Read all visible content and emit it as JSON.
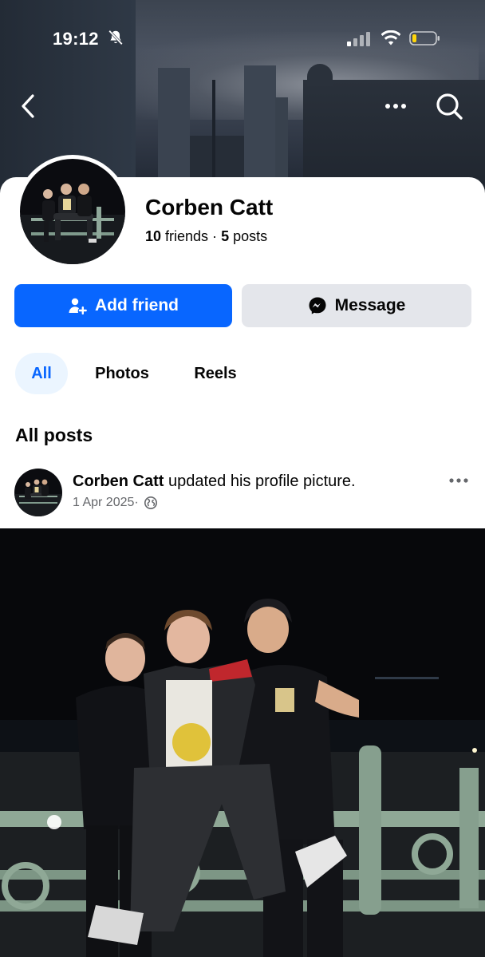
{
  "status_bar": {
    "time": "19:12",
    "icons": [
      "bell-slash-icon",
      "signal-icon",
      "wifi-icon",
      "battery-low-icon"
    ]
  },
  "nav": {
    "icons": [
      "back-chevron-icon",
      "more-horizontal-icon",
      "search-icon"
    ]
  },
  "profile": {
    "name": "Corben Catt",
    "friends_count": "10",
    "friends_label": " friends · ",
    "posts_count": "5",
    "posts_label": " posts"
  },
  "actions": {
    "add_friend_label": "Add friend",
    "message_label": "Message"
  },
  "tabs": [
    {
      "label": "All",
      "selected": true
    },
    {
      "label": "Photos",
      "selected": false
    },
    {
      "label": "Reels",
      "selected": false
    }
  ],
  "section": {
    "title": "All posts"
  },
  "post": {
    "author": "Corben Catt",
    "action": " updated his profile picture.",
    "date": "1 Apr 2025",
    "separator": " · ",
    "audience_icon": "globe-icon"
  },
  "colors": {
    "primary": "#0866ff",
    "secondary_button": "#e4e6eb",
    "selected_tab_bg": "#ebf5ff",
    "text": "#050505",
    "muted_text": "#65676b"
  }
}
